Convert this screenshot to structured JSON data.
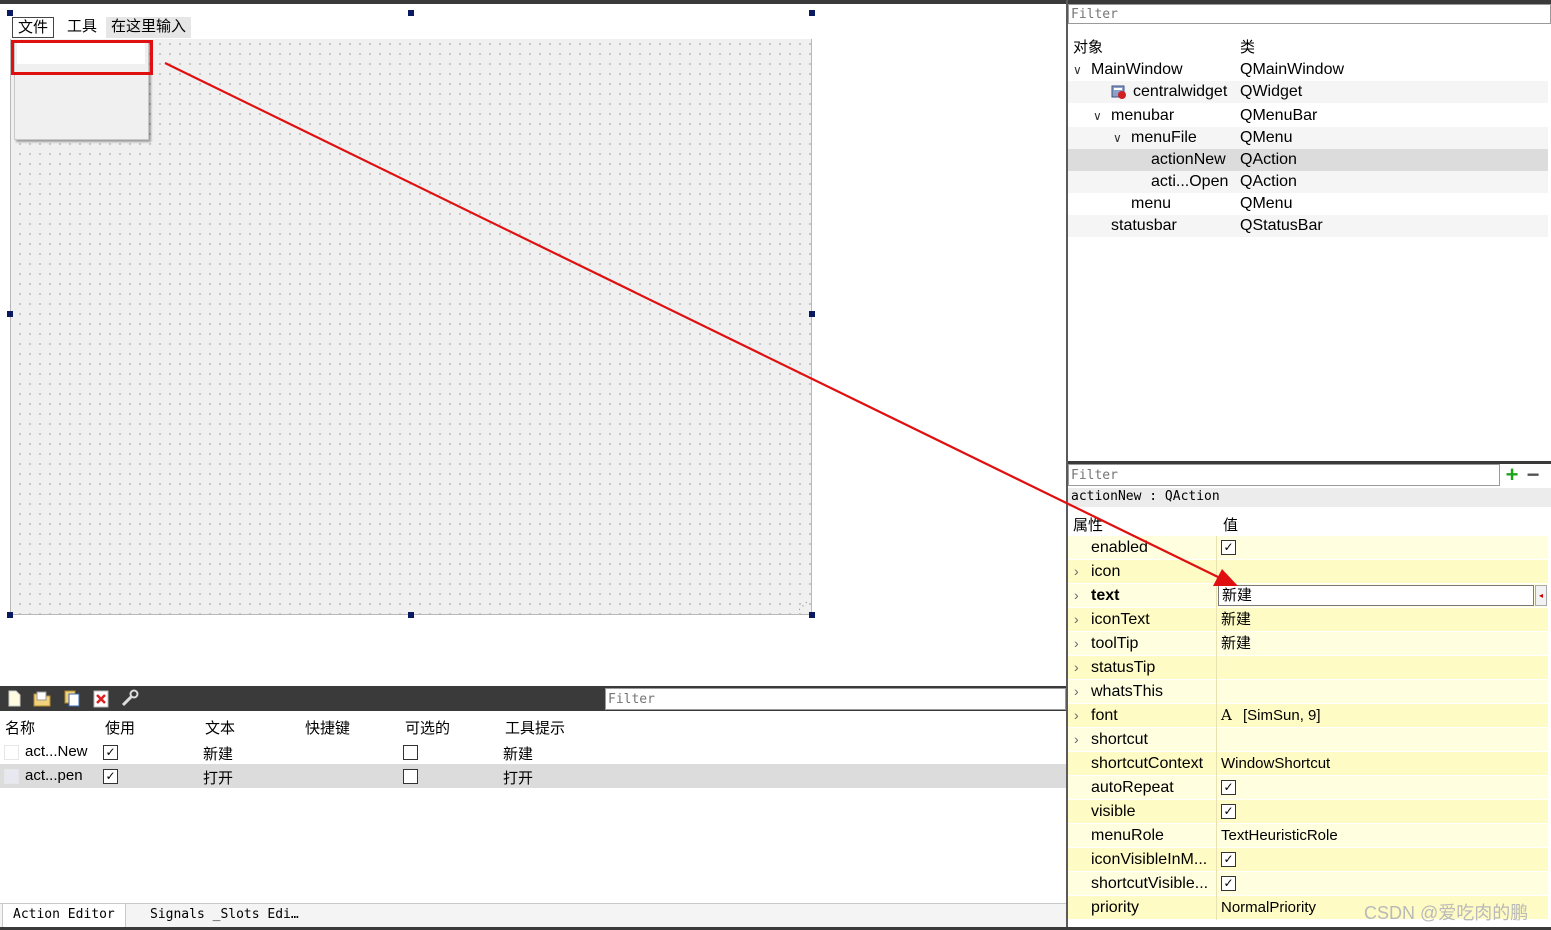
{
  "form": {
    "menubar": {
      "file": "文件",
      "tools": "工具",
      "type_here": "在这里输入"
    }
  },
  "object_inspector": {
    "filter_placeholder": "Filter",
    "header": {
      "object": "对象",
      "class": "类"
    },
    "rows": [
      {
        "name": "MainWindow",
        "class": "QMainWindow"
      },
      {
        "name": "centralwidget",
        "class": "QWidget"
      },
      {
        "name": "menubar",
        "class": "QMenuBar"
      },
      {
        "name": "menuFile",
        "class": "QMenu"
      },
      {
        "name": "actionNew",
        "class": "QAction"
      },
      {
        "name": "acti...Open",
        "class": "QAction"
      },
      {
        "name": "menu",
        "class": "QMenu"
      },
      {
        "name": "statusbar",
        "class": "QStatusBar"
      }
    ]
  },
  "property_editor": {
    "filter_placeholder": "Filter",
    "object_label": "actionNew : QAction",
    "header": {
      "property": "属性",
      "value": "值"
    },
    "rows": [
      {
        "name": "enabled",
        "value": ""
      },
      {
        "name": "icon",
        "value": ""
      },
      {
        "name": "text",
        "value": "新建"
      },
      {
        "name": "iconText",
        "value": "新建"
      },
      {
        "name": "toolTip",
        "value": "新建"
      },
      {
        "name": "statusTip",
        "value": ""
      },
      {
        "name": "whatsThis",
        "value": ""
      },
      {
        "name": "font",
        "value": "[SimSun, 9]",
        "icon_glyph": "A"
      },
      {
        "name": "shortcut",
        "value": ""
      },
      {
        "name": "shortcutContext",
        "value": "WindowShortcut"
      },
      {
        "name": "autoRepeat",
        "value": ""
      },
      {
        "name": "visible",
        "value": ""
      },
      {
        "name": "menuRole",
        "value": "TextHeuristicRole"
      },
      {
        "name": "iconVisibleInM...",
        "value": ""
      },
      {
        "name": "shortcutVisible...",
        "value": ""
      },
      {
        "name": "priority",
        "value": "NormalPriority"
      }
    ],
    "checkbox_mark": "✓"
  },
  "action_editor": {
    "filter_placeholder": "Filter",
    "header": {
      "name": "名称",
      "used": "使用",
      "text": "文本",
      "shortcut": "快捷键",
      "checkable": "可选的",
      "tooltip": "工具提示"
    },
    "rows": [
      {
        "name": "act...New",
        "text": "新建",
        "tooltip": "新建"
      },
      {
        "name": "act...pen",
        "text": "打开",
        "tooltip": "打开"
      }
    ],
    "tabs": [
      "Action Editor",
      "Signals _Slots Edi…"
    ]
  },
  "watermark": "CSDN @爱吃肉的鹏",
  "colors": {
    "highlight_red": "#e01010",
    "property_yellow": "#ffffe0",
    "property_yellow_alt": "#fffbc4",
    "selection_gray": "#dcdcdc",
    "add_green": "#1aa51a"
  },
  "icons": [
    "new-action-icon",
    "open-folder-icon",
    "copy-icon",
    "delete-icon",
    "configure-icon",
    "chevron-down-icon",
    "chevron-right-icon",
    "widget-icon",
    "font-icon",
    "reset-icon",
    "plus-icon",
    "minus-icon"
  ]
}
